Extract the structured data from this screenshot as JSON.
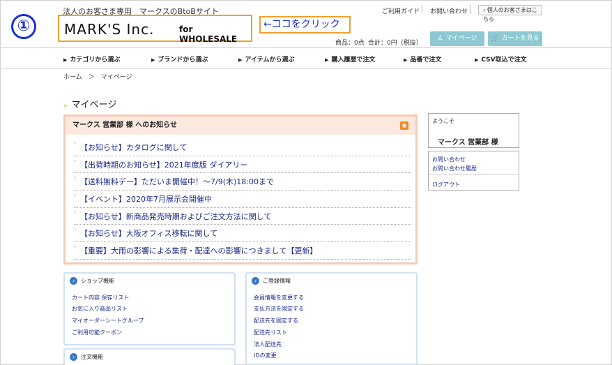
{
  "annotation": {
    "step": "①",
    "hint": "←ココをクリック"
  },
  "header": {
    "tagline": "法人のお客さま専用　マークスのBtoBサイト",
    "logo_main": "MARK'S Inc.",
    "logo_sub": "for WHOLESALE",
    "guide_link": "ご利用ガイド",
    "contact_link": "お問い合わせ",
    "individual_link": "個人のお客さまはこちら",
    "points": "商品：0点",
    "total": "合計：0円（税抜）",
    "mypage_button": "マイページ",
    "cart_button": "カートを見る"
  },
  "nav": [
    {
      "label": "カテゴリから選ぶ"
    },
    {
      "label": "ブランドから選ぶ"
    },
    {
      "label": "アイテムから選ぶ"
    },
    {
      "label": "購入履歴で注文"
    },
    {
      "label": "品番で注文"
    },
    {
      "label": "CSV取込で注文"
    }
  ],
  "breadcrumb": "ホーム　＞　マイページ",
  "page_title": "マイページ",
  "notices": {
    "heading": "マークス 営業部 様 へのお知らせ",
    "items": [
      "【お知らせ】カタログに関して",
      "【出荷時期のお知らせ】2021年度版 ダイアリー",
      "【送料無料デー】ただいま開催中！～7/9(木)18:00まで",
      "【イベント】2020年7月展示会開催中",
      "【お知らせ】新商品発売時期およびご注文方法に関して",
      "【お知らせ】大阪オフィス移転に関して",
      "【重要】大雨の影響による集荷・配達への影響につきまして【更新】"
    ]
  },
  "sidebar": {
    "welcome": "ようこそ",
    "user_name": "マークス 営業部 様",
    "contact": "お問い合わせ",
    "contact_history": "お問い合わせ履歴",
    "logout": "ログアウト"
  },
  "shop_box": {
    "title": "ショップ機能",
    "links": [
      "カート内容 保存リスト",
      "お気に入り商品リスト",
      "マイオーダーシートグループ",
      "ご利用可能クーポン"
    ]
  },
  "register_box": {
    "title": "ご登録情報",
    "links": [
      "会員情報を変更する",
      "支払方法を固定する",
      "配送先を固定する",
      "配送先リスト",
      "法人配送先",
      "IDの変更"
    ]
  },
  "order_box": {
    "title": "注文機能"
  },
  "colors": {
    "accent_orange": "#f0a030",
    "annotation_blue": "#1a2fd6",
    "button_teal": "#8ec8d2",
    "notice_border": "#f5cbb7"
  }
}
